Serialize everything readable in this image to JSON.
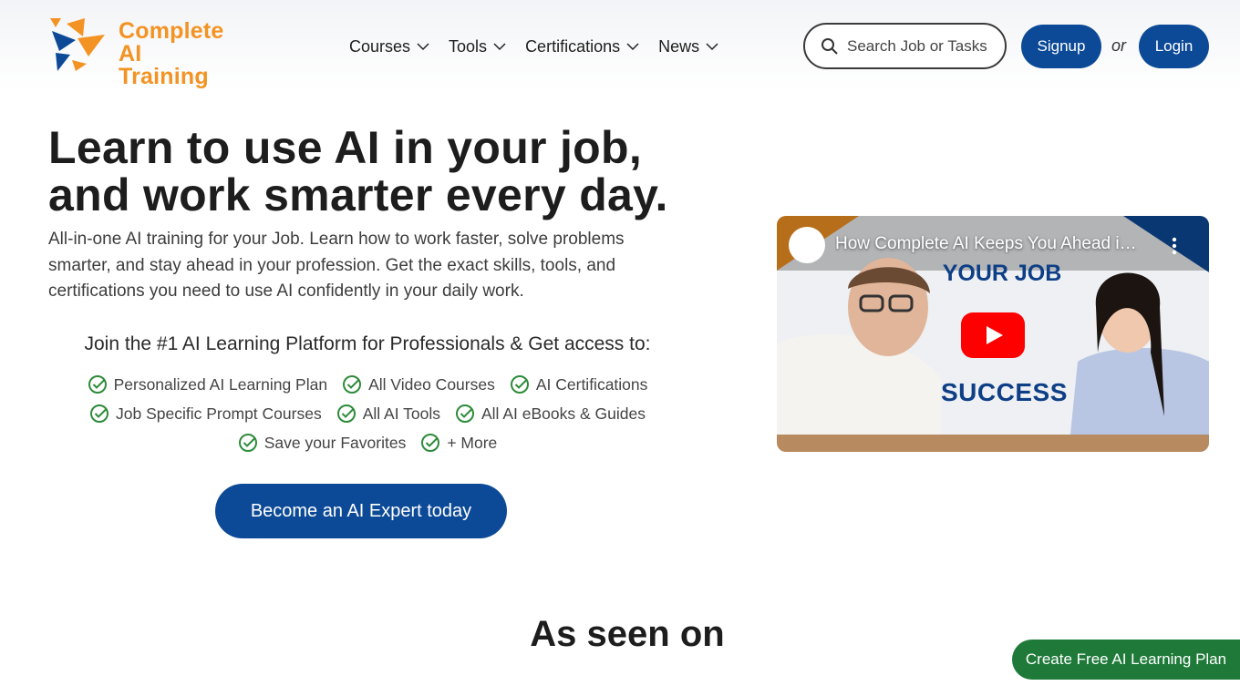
{
  "brand": {
    "line1": "Complete",
    "line2": "AI Training",
    "color": "#f39323"
  },
  "nav": {
    "items": [
      {
        "label": "Courses"
      },
      {
        "label": "Tools"
      },
      {
        "label": "Certifications"
      },
      {
        "label": "News"
      }
    ]
  },
  "search": {
    "placeholder": "Search Job or Tasks"
  },
  "auth": {
    "signup": "Signup",
    "or": "or",
    "login": "Login"
  },
  "hero": {
    "title": "Learn to use AI in your job, and work smarter every day.",
    "description": "All-in-one AI training for your Job. Learn how to work faster, solve problems smarter, and stay ahead in your profession. Get the exact skills, tools, and certifications you need to use AI confidently in your daily work.",
    "join": "Join the #1 AI Learning Platform for Professionals & Get access to:",
    "features": [
      [
        "Personalized AI Learning Plan",
        "All Video Courses",
        "AI Certifications"
      ],
      [
        "Job Specific Prompt Courses",
        "All AI Tools",
        "All AI eBooks & Guides"
      ],
      [
        "Save your Favorites",
        "+ More"
      ]
    ],
    "cta": "Become an AI Expert today"
  },
  "video": {
    "title": "How Complete AI Keeps You Ahead in Your Job",
    "overlay_top": "YOUR JOB",
    "overlay_bottom": "SUCCESS",
    "play_icon": "youtube-play-icon"
  },
  "seen_on": {
    "heading": "As seen on"
  },
  "floating": {
    "label": "Create Free AI Learning Plan"
  },
  "colors": {
    "primary_blue": "#0c4a97",
    "check_green": "#2e8b3a",
    "float_green": "#1f7a3a"
  }
}
